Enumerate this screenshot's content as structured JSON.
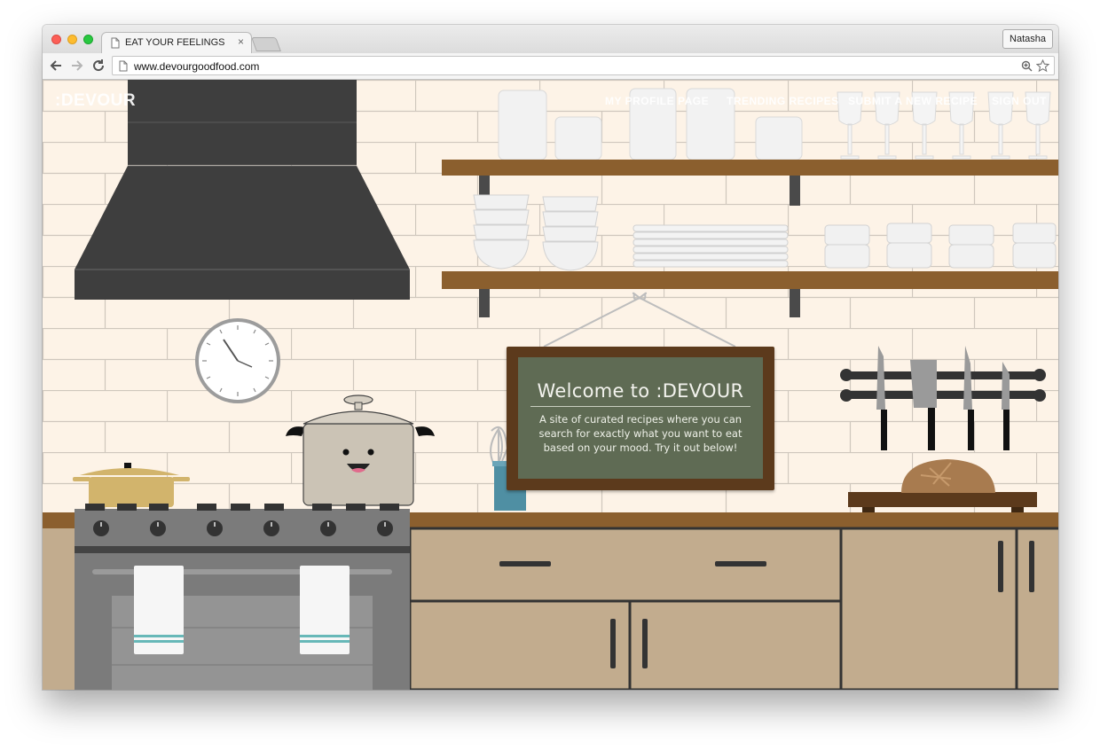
{
  "browser": {
    "tab_title": "EAT YOUR FEELINGS",
    "tab_close": "×",
    "user_button": "Natasha",
    "url": "www.devourgoodfood.com",
    "icons": [
      "back-arrow-icon",
      "forward-arrow-icon",
      "reload-icon",
      "page-icon",
      "zoom-icon",
      "star-icon"
    ]
  },
  "site": {
    "brand": ":DEVOUR",
    "nav": {
      "profile": "MY PROFILE PAGE",
      "trending": "TRENDING RECIPES",
      "submit": "SUBMIT A NEW RECIPE",
      "signout": "SIGN OUT"
    },
    "welcome": {
      "title": "Welcome to :DEVOUR",
      "text": "A site of curated recipes where you can search for exactly what you want to eat based on your mood. Try it out below!"
    }
  },
  "colors": {
    "wall": "#fdf3e7",
    "grout": "#cfc7bd",
    "shelf": "#8b5f2e",
    "hood": "#3e3e3e",
    "counter": "#8b5f2e",
    "cabinet": "#c2ac8e",
    "stove": "#7b7b7b",
    "board_frame": "#5c3a1c",
    "board_face": "#5f6b54"
  }
}
